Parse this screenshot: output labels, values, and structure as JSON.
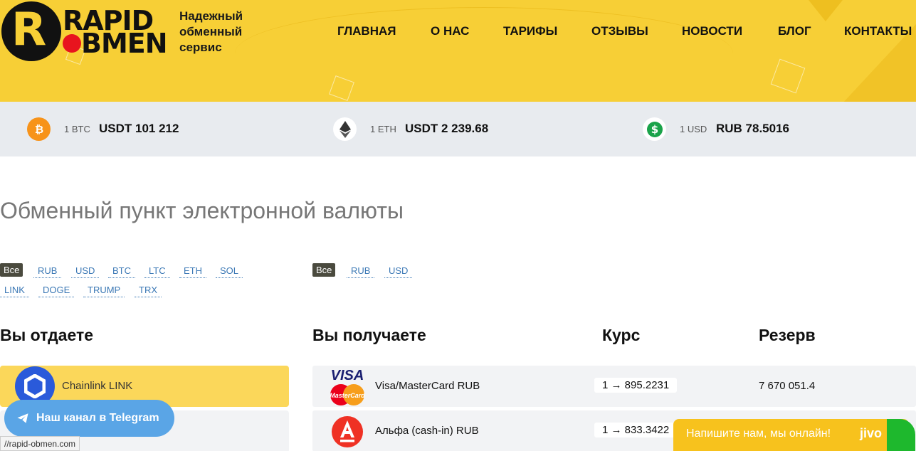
{
  "header": {
    "logo_top": "RAPID",
    "logo_bottom": "BMEN",
    "logo_letter": "R",
    "tagline": "Надежный обменный сервис",
    "nav": [
      "ГЛАВНАЯ",
      "О НАС",
      "ТАРИФЫ",
      "ОТЗЫВЫ",
      "НОВОСТИ",
      "БЛОГ",
      "КОНТАКТЫ"
    ]
  },
  "rates": [
    {
      "icon": "bitcoin-icon",
      "unit": "1 BTC",
      "value": "USDT 101 212"
    },
    {
      "icon": "ethereum-icon",
      "unit": "1 ETH",
      "value": "USDT 2 239.68"
    },
    {
      "icon": "dollar-icon",
      "unit": "1 USD",
      "value": "RUB 78.5016"
    }
  ],
  "page_title": "Обменный пункт электронной валюты",
  "give_filters": [
    "Все",
    "RUB",
    "USD",
    "BTC",
    "LTC",
    "ETH",
    "SOL",
    "LINK",
    "DOGE",
    "TRUMP",
    "TRX"
  ],
  "get_filters": [
    "Все",
    "RUB",
    "USD"
  ],
  "columns": {
    "give": "Вы отдаете",
    "get": "Вы получаете",
    "rate": "Курс",
    "reserve": "Резерв"
  },
  "give_list": [
    {
      "name": "Chainlink LINK",
      "selected": true
    }
  ],
  "get_list": [
    {
      "name": "Visa/MasterCard RUB",
      "rate": "1 → 895.2231",
      "reserve": "7 670 051.4"
    },
    {
      "name": "Альфа (cash-in) RUB",
      "rate": "1 → 833.3422",
      "reserve": ""
    }
  ],
  "telegram_button": "Наш канал в Telegram",
  "status_url": "//rapid-obmen.com",
  "chat": {
    "message": "Напишите нам, мы онлайн!",
    "brand": "jivo"
  },
  "colors": {
    "brand_yellow": "#f7cf36",
    "link_blue": "#3b78b5",
    "telegram": "#5aa5e6"
  }
}
